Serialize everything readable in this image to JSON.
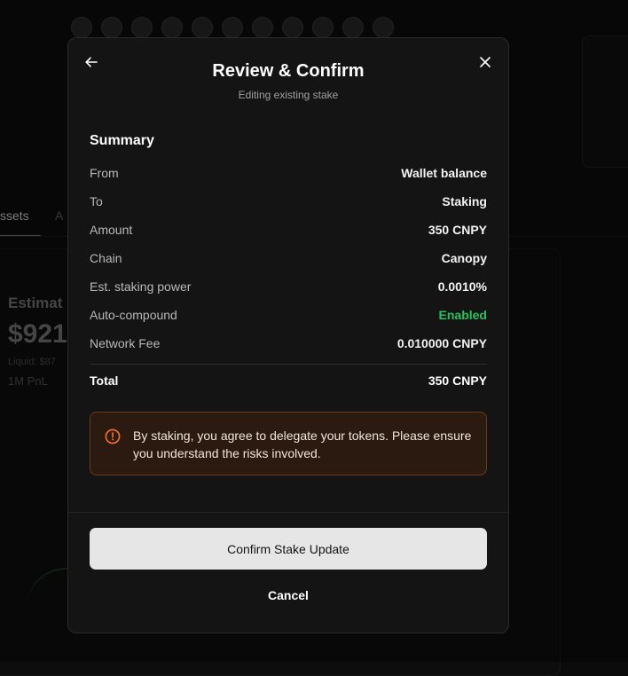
{
  "modal": {
    "title": "Review & Confirm",
    "subtitle": "Editing existing stake",
    "summary_heading": "Summary",
    "rows": [
      {
        "label": "From",
        "value": "Wallet balance"
      },
      {
        "label": "To",
        "value": "Staking"
      },
      {
        "label": "Amount",
        "value": "350 CNPY"
      },
      {
        "label": "Chain",
        "value": "Canopy"
      },
      {
        "label": "Est. staking power",
        "value": "0.0010%"
      },
      {
        "label": "Auto-compound",
        "value": "Enabled",
        "status_color": "#22c55e"
      },
      {
        "label": "Network Fee",
        "value": "0.010000 CNPY"
      }
    ],
    "total": {
      "label": "Total",
      "value": "350 CNPY"
    },
    "warning": "By staking, you agree to delegate your tokens. Please ensure you understand the risks involved.",
    "confirm_label": "Confirm Stake Update",
    "cancel_label": "Cancel",
    "icons": {
      "back": "arrow-left-icon",
      "close": "close-icon",
      "warning": "alert-circle-icon"
    },
    "colors": {
      "accent_warning": "#f97316",
      "enabled": "#22c55e"
    }
  },
  "background": {
    "tab_active": "ssets",
    "tab_second": "A",
    "estimate_label": "Estimat",
    "estimate_value": "$921",
    "liquid_text": "Liquid: $87",
    "pnl_text": "1M PnL"
  }
}
